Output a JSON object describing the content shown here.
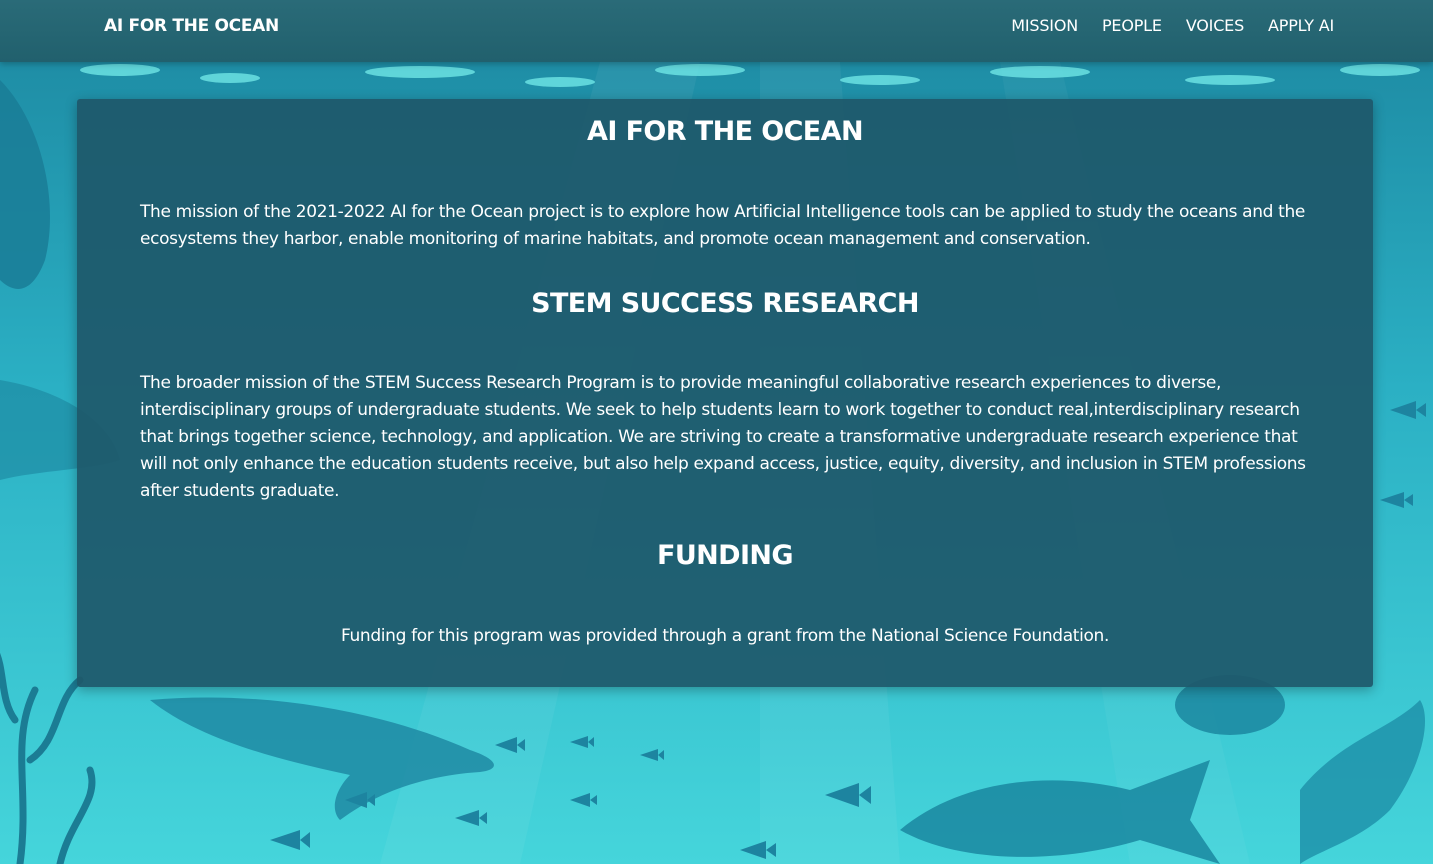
{
  "nav": {
    "brand": "AI FOR THE OCEAN",
    "links": [
      "MISSION",
      "PEOPLE",
      "VOICES",
      "APPLY AI"
    ]
  },
  "sections": [
    {
      "title": "AI FOR THE OCEAN",
      "text": "The mission of the 2021-2022 AI for the Ocean project is to explore how Artificial Intelligence tools can be applied to study the oceans and the ecosystems they harbor, enable monitoring of marine habitats, and promote ocean management and conservation."
    },
    {
      "title": "STEM SUCCESS RESEARCH",
      "text": "The broader mission of the STEM Success Research Program is to provide meaningful collaborative research experiences to diverse, interdisciplinary groups of undergraduate students. We seek to help students learn to work together to conduct real,interdisciplinary research that brings together science, technology, and application. We are striving to create a transformative undergraduate research experience that will not only enhance the education students receive, but also help expand access, justice, equity, diversity, and inclusion in STEM professions after students graduate."
    },
    {
      "title": "FUNDING",
      "text": "Funding for this program was provided through a grant from the National Science Foundation."
    }
  ],
  "colors": {
    "navbar": "#21606d",
    "card": "#1e586a",
    "ocean_light": "#46d6dc",
    "ocean_dark": "#1f8fa6",
    "silhouette": "#1f8aa3"
  }
}
